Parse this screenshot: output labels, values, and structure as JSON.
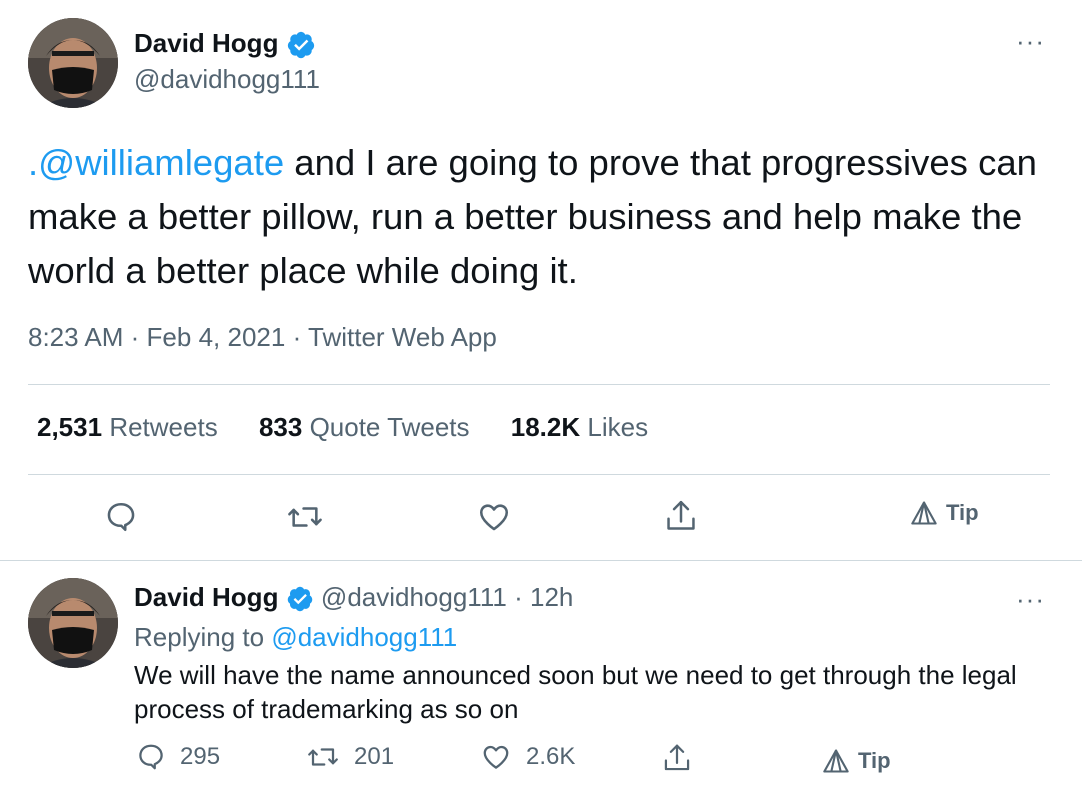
{
  "main_tweet": {
    "author_name": "David Hogg",
    "author_handle": "@davidhogg111",
    "mention": ".@williamlegate",
    "text": " and I are going to prove that progressives can make a better pillow, run a better business and help make the world a better place while doing it.",
    "time": "8:23 AM",
    "date": "Feb 4, 2021",
    "source": "Twitter Web App",
    "separator": "·",
    "stats": {
      "retweets_count": "2,531",
      "retweets_label": "Retweets",
      "quotes_count": "833",
      "quotes_label": "Quote Tweets",
      "likes_count": "18.2K",
      "likes_label": "Likes"
    },
    "actions": [
      "reply-icon",
      "retweet-icon",
      "like-icon",
      "share-icon",
      "tip-icon"
    ],
    "tip_label": "Tip"
  },
  "reply_tweet": {
    "author_name": "David Hogg",
    "author_handle": "@davidhogg111",
    "separator": "·",
    "age": "12h",
    "replying_prefix": "Replying to",
    "replying_handle": "@davidhogg111",
    "text": "We will have the name announced soon but we need to get through the legal process of trademarking as so on",
    "replies": "295",
    "retweets": "201",
    "likes": "2.6K",
    "tip_label": "Tip"
  },
  "more_label": "···",
  "colors": {
    "accent": "#1d9bf0",
    "text": "#0f1419",
    "secondary": "#536471",
    "divider": "#cfd9de"
  }
}
